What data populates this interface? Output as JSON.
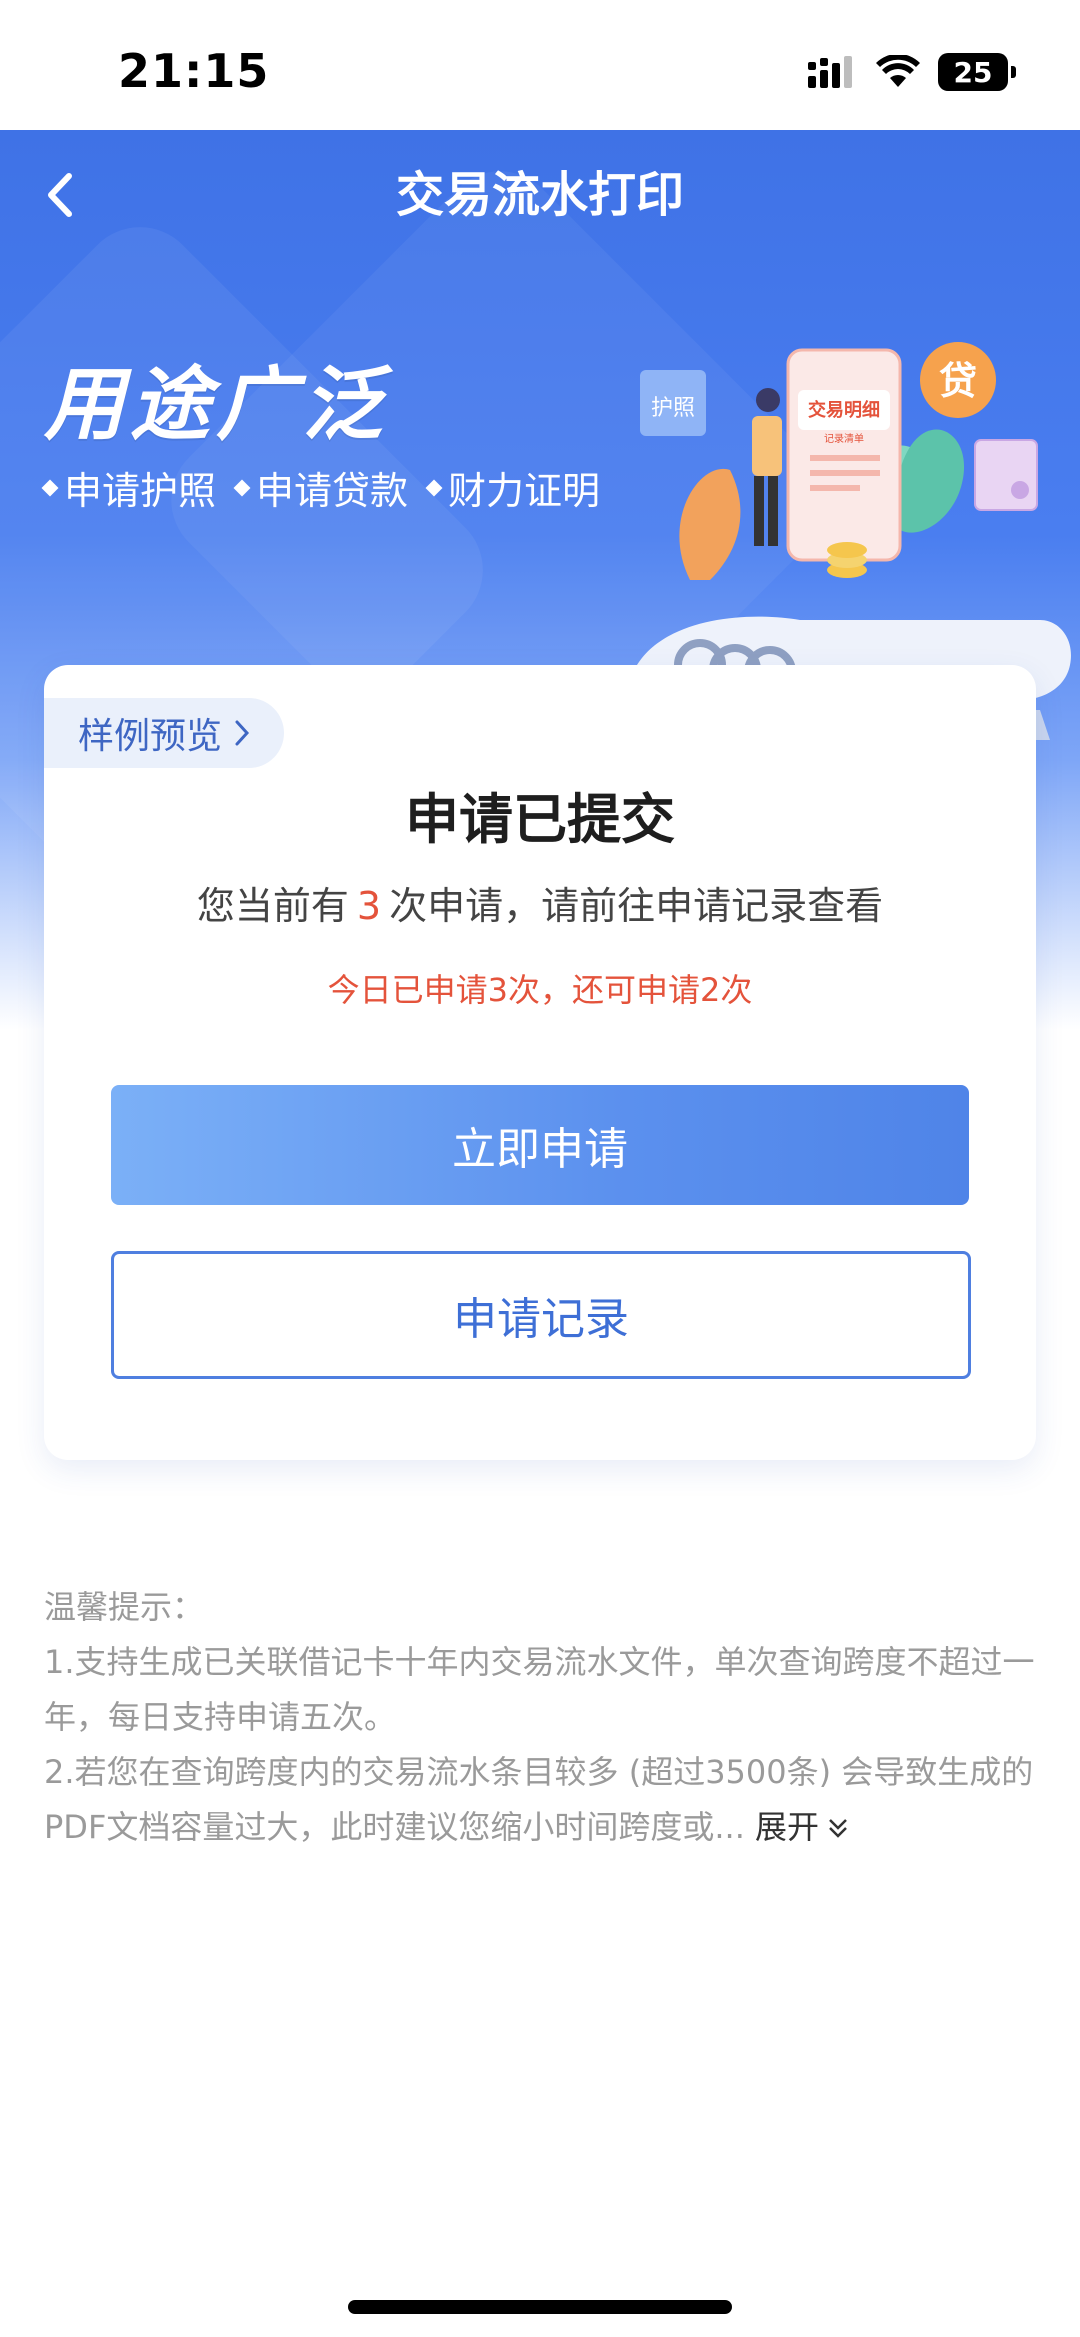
{
  "status_bar": {
    "time": "21:15",
    "battery": "25"
  },
  "nav": {
    "title": "交易流水打印"
  },
  "hero": {
    "headline": "用途广泛",
    "tags": [
      "申请护照",
      "申请贷款",
      "财力证明"
    ],
    "illustration": {
      "doc_title": "交易明细",
      "doc_sub": "记录清单",
      "badge_passport": "护照",
      "badge_loan": "贷"
    }
  },
  "card": {
    "preview_label": "样例预览",
    "title": "申请已提交",
    "sub_prefix": "您当前有",
    "count": "3",
    "sub_suffix": "次申请，请前往申请记录查看",
    "warning": "今日已申请3次，还可申请2次",
    "primary_button": "立即申请",
    "secondary_button": "申请记录"
  },
  "tips": {
    "title": "温馨提示：",
    "line1": "1.支持生成已关联借记卡十年内交易流水文件，单次查询跨度不超过一年，每日支持申请五次。",
    "line2": "2.若您在查询跨度内的交易流水条目较多 (超过3500条) 会导致生成的PDF文档容量过大，此时建议您缩小时间跨度或...",
    "expand_label": "展开"
  },
  "colors": {
    "brand": "#4a7ef0",
    "warn": "#e4533b",
    "link": "#3e6fd6"
  }
}
